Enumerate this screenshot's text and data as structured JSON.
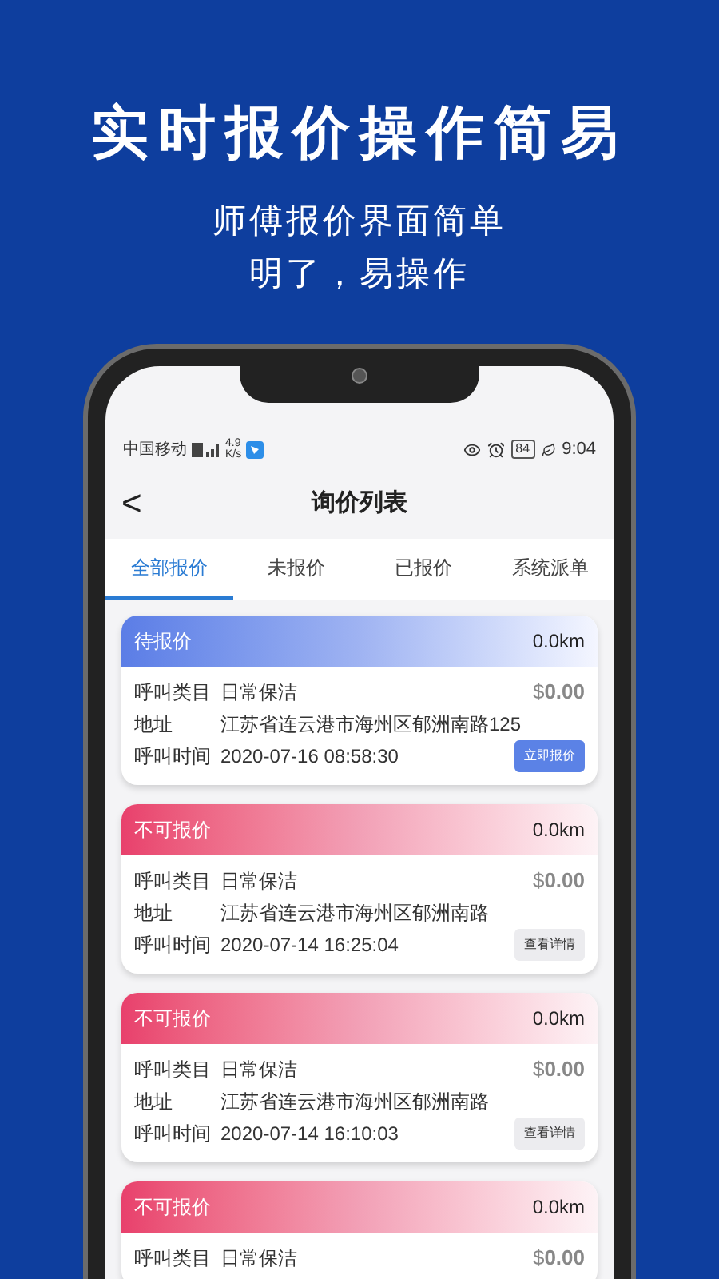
{
  "headline": "实时报价操作简易",
  "subtitle_lines": [
    "师傅报价界面简单",
    "明了，易操作"
  ],
  "status_bar": {
    "carrier": "中国移动",
    "speed_value": "4.9",
    "speed_unit": "K/s",
    "battery": "84",
    "time": "9:04"
  },
  "header": {
    "back": "<",
    "title": "询价列表"
  },
  "tabs": [
    {
      "label": "全部报价",
      "selected": true
    },
    {
      "label": "未报价",
      "selected": false
    },
    {
      "label": "已报价",
      "selected": false
    },
    {
      "label": "系统派单",
      "selected": false
    }
  ],
  "cards": [
    {
      "kind": "pending",
      "status": "待报价",
      "distance": "0.0km",
      "price": "$**0.00**",
      "fields": [
        {
          "label": "呼叫类目",
          "value": "日常保洁"
        },
        {
          "label": "地址",
          "value": "江苏省连云港市海州区郁洲南路125"
        },
        {
          "label": "呼叫时间",
          "value": "2020-07-16 08:58:30"
        }
      ],
      "button": {
        "kind": "primary",
        "label": "立即报价"
      }
    },
    {
      "kind": "closed",
      "status": "不可报价",
      "distance": "0.0km",
      "price": "$**0.00**",
      "fields": [
        {
          "label": "呼叫类目",
          "value": "日常保洁"
        },
        {
          "label": "地址",
          "value": "江苏省连云港市海州区郁洲南路"
        },
        {
          "label": "呼叫时间",
          "value": "2020-07-14 16:25:04"
        }
      ],
      "button": {
        "kind": "secondary",
        "label": "查看详情"
      }
    },
    {
      "kind": "closed",
      "status": "不可报价",
      "distance": "0.0km",
      "price": "$**0.00**",
      "fields": [
        {
          "label": "呼叫类目",
          "value": "日常保洁"
        },
        {
          "label": "地址",
          "value": "江苏省连云港市海州区郁洲南路"
        },
        {
          "label": "呼叫时间",
          "value": "2020-07-14 16:10:03"
        }
      ],
      "button": {
        "kind": "secondary",
        "label": "查看详情"
      }
    },
    {
      "kind": "closed",
      "status": "不可报价",
      "distance": "0.0km",
      "price": "$**0.00**",
      "fields": [
        {
          "label": "呼叫类目",
          "value": "日常保洁"
        }
      ]
    }
  ]
}
